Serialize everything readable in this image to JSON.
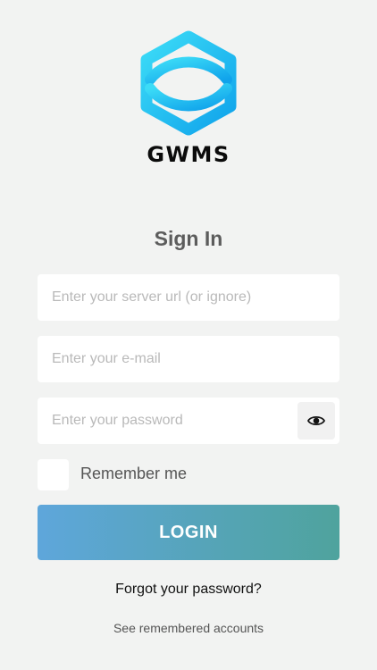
{
  "brand": {
    "name": "GWMS",
    "logo_icon": "gwms-hexagon-logo",
    "gradient_start": "#39d6f5",
    "gradient_end": "#12a6ec"
  },
  "page": {
    "title": "Sign In"
  },
  "form": {
    "server_url_placeholder": "Enter your server url (or ignore)",
    "server_url_value": "",
    "email_placeholder": "Enter your e-mail",
    "email_value": "",
    "password_placeholder": "Enter your password",
    "password_value": "",
    "password_toggle_icon": "eye-icon",
    "remember_me_label": "Remember me",
    "remember_me_checked": false,
    "login_label": "LOGIN",
    "login_gradient": [
      "#5ea6db",
      "#4fa39d"
    ]
  },
  "links": {
    "forgot_password": "Forgot your password?",
    "remembered_accounts": "See remembered accounts"
  }
}
